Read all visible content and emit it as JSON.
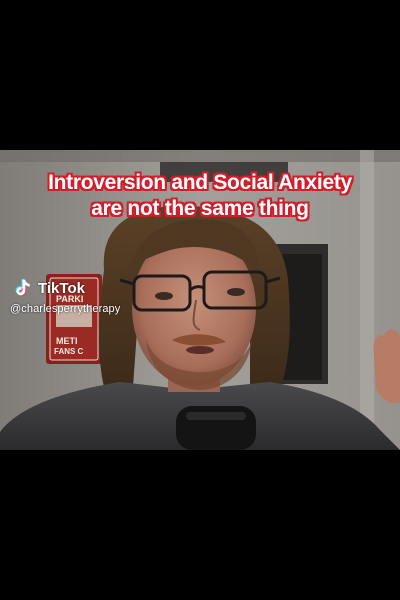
{
  "caption": {
    "line1": "Introversion and Social Anxiety",
    "line2": "are not the same thing"
  },
  "watermark": {
    "brand": "TikTok",
    "handle": "@charlesperrytherapy",
    "logo_icon": "tiktok-logo-icon"
  },
  "wall_sign": {
    "line1": "PARKI",
    "line2": "METI",
    "line3": "FANS C"
  },
  "colors": {
    "caption_outline": "#d11e2a",
    "caption_text": "#ffffff",
    "background": "#000000",
    "wall": "#9b9893",
    "sign_red": "#8a1f1d"
  }
}
